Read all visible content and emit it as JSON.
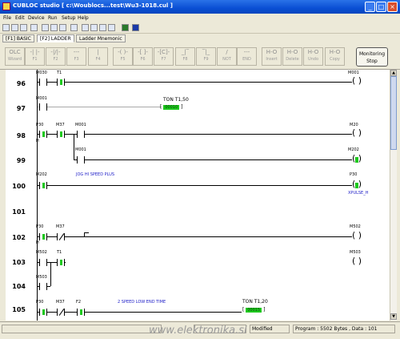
{
  "window": {
    "title": "CUBLOC studio [ c:\\Woublocs...test\\Wu3-1018.cul ]"
  },
  "menu": [
    "File",
    "Edit",
    "Device",
    "Run",
    "Setup",
    "Help"
  ],
  "tabs": [
    "[F1] BASIC",
    "[F2] LADDER",
    "Ladder Mnemonic"
  ],
  "ladder_toolbar": {
    "buttons": [
      {
        "sym": "OLC",
        "label": "Wizard"
      },
      {
        "sym": "-| |-",
        "label": "F1"
      },
      {
        "sym": "-|/|-",
        "label": "F2"
      },
      {
        "sym": "---",
        "label": "F3"
      },
      {
        "sym": "|",
        "label": "F4"
      },
      {
        "sym": "-( )-",
        "label": "F5"
      },
      {
        "sym": "-[ ]-",
        "label": "F6"
      },
      {
        "sym": "-[C]-",
        "label": "F7"
      },
      {
        "sym": "_|‾",
        "label": "F8"
      },
      {
        "sym": "‾|_",
        "label": "F9"
      },
      {
        "sym": "/",
        "label": "NOT"
      },
      {
        "sym": "---",
        "label": "END"
      },
      {
        "sym": "H-O",
        "label": "Insert"
      },
      {
        "sym": "H-O",
        "label": "Delete"
      },
      {
        "sym": "H-O",
        "label": "Undo"
      },
      {
        "sym": "H-O",
        "label": "Copy"
      }
    ],
    "mnemonic_button": "Monitoring Stop"
  },
  "rungs": [
    {
      "num": "96"
    },
    {
      "num": "97"
    },
    {
      "num": "98"
    },
    {
      "num": "99"
    },
    {
      "num": "100"
    },
    {
      "num": "101"
    },
    {
      "num": "102"
    },
    {
      "num": "103"
    },
    {
      "num": "104"
    },
    {
      "num": "105"
    }
  ],
  "labels": {
    "r96": {
      "c1": "M030",
      "c2": "T1",
      "coil": "M001"
    },
    "r97": {
      "c1": "M001",
      "box": "TON T1,50",
      "val": "00010"
    },
    "r98": {
      "c1": "P30",
      "c1sub": "H",
      "c2": "M37",
      "c3": "M001",
      "coil": "M20"
    },
    "r99": {
      "c1": "M001",
      "coil": "M202"
    },
    "r100": {
      "c1": "M202",
      "comment": "JOG HI SPEED PLUS",
      "coil": "P30",
      "coilsub": "XPULSE_H"
    },
    "r102": {
      "c1": "P30",
      "c1sub": "H",
      "c2": "M37",
      "coil": "M502"
    },
    "r103": {
      "c1": "M502",
      "c2": "T1",
      "coil": "M503"
    },
    "r104": {
      "c1": "M503"
    },
    "r105": {
      "c1": "P30",
      "c2": "M37",
      "c3": "F2",
      "comment": "2 SPEED LOW END TIME",
      "box": "TON T1,20",
      "val": "00015"
    }
  },
  "status": {
    "position": "",
    "modified": "Modified",
    "program": "Program : 5502 Bytes , Data : 101"
  },
  "watermark": "www.elektronika.si",
  "colors": {
    "title": "#0a4fd4",
    "active_contact": "#1fc91f",
    "comment": "#2020c8"
  }
}
